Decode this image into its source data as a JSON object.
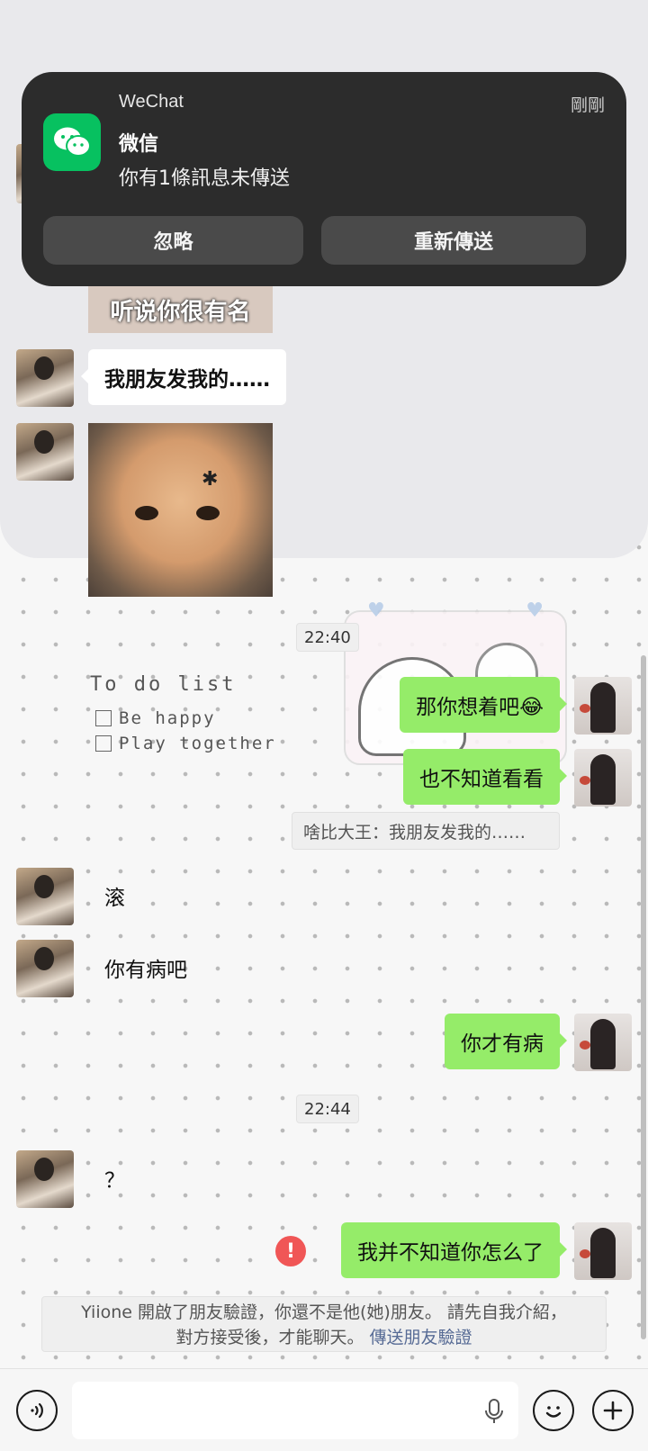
{
  "colors": {
    "bubble_out": "#95ec69",
    "bubble_in": "#ffffff",
    "wechat_green": "#07c160",
    "error_red": "#f05656",
    "link_blue": "#576b95"
  },
  "background": {
    "todo_title": "To do list",
    "todo_items": [
      "Be happy",
      "Play together"
    ]
  },
  "upper_chat": {
    "sticker_caption": "听说你很有名",
    "message_1": "我朋友发我的……"
  },
  "notification": {
    "app_name": "WeChat",
    "time": "剛剛",
    "title": "微信",
    "body": "你有1條訊息未傳送",
    "ignore_label": "忽略",
    "resend_label": "重新傳送",
    "icon": "wechat-icon"
  },
  "chat": {
    "timestamp_1": "22:40",
    "out_1": "那你想着吧😂",
    "out_2": "也不知道看看",
    "quote": "啥比大王：我朋友发我的……",
    "in_1": "滚",
    "in_2": "你有病吧",
    "out_3": "你才有病",
    "timestamp_2": "22:44",
    "in_3": "？",
    "out_4": "我并不知道你怎么了",
    "error_mark": "!"
  },
  "system_notice": {
    "line_1": "Yiione 開啟了朋友驗證，你還不是他(她)朋友。 請先自我介紹，",
    "line_2": "對方接受後，才能聊天。",
    "link": "傳送朋友驗證"
  },
  "input_bar": {
    "voice_icon": "voice-icon",
    "mic_icon": "mic-icon",
    "emoji_icon": "emoji-icon",
    "plus_icon": "plus-icon"
  }
}
